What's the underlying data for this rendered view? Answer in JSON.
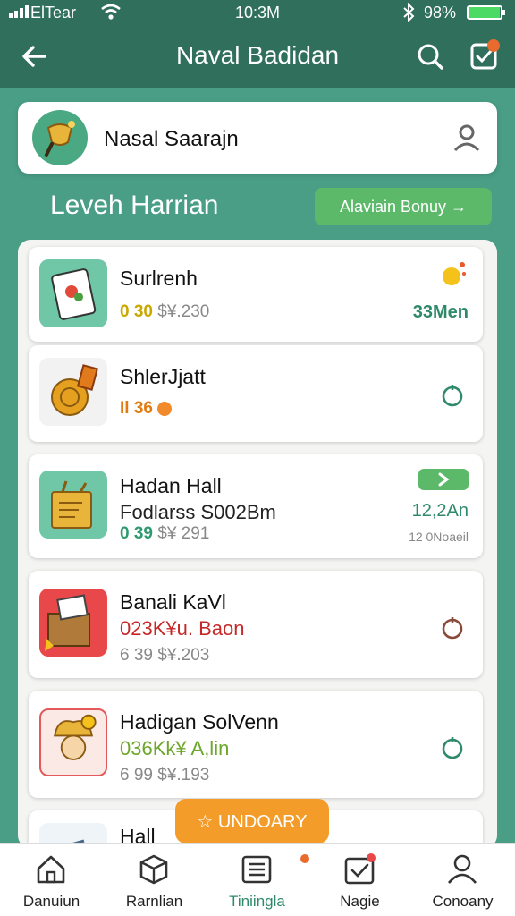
{
  "status_bar": {
    "carrier": "ElTear",
    "time": "10:3M",
    "battery": "98%",
    "battery_level": 0.98
  },
  "header": {
    "title": "Naval Badidan",
    "icons": [
      "back-arrow-icon",
      "search-icon",
      "tasks-icon"
    ]
  },
  "profile": {
    "name": "Nasal Saarajn",
    "icon": "person-icon"
  },
  "section": {
    "title": "Leveh Harrian",
    "button_label": "Alaviain Bonuy →"
  },
  "items": [
    {
      "name": "Surlrenh",
      "meta_highlight": "0 30",
      "meta_rest": " $¥.230",
      "right_value": "33Men",
      "accent": "#c9a800"
    },
    {
      "name": "ShlerJjatt",
      "meta_highlight": "Il 36",
      "meta_rest": "",
      "accent": "#e27a12"
    },
    {
      "name": "Hadan Hall",
      "subtitle": "Fodlarss S002Bm",
      "meta_highlight": "0 39",
      "meta_rest": " $¥ 291",
      "right_value": "12,2An",
      "right_sub": "12 0Noaeil",
      "accent": "#2f9a6f"
    },
    {
      "name": "Banali KaVl",
      "subtitle": "023K¥u. Baon",
      "meta_rest": "6 39 $¥.203",
      "accent": "#c62828"
    },
    {
      "name": "Hadigan SolVenn",
      "subtitle": "036Kk¥ A,lin",
      "meta_rest": "6 99 $¥.193",
      "accent": "#6ca62a"
    },
    {
      "name": "Hall",
      "accent": "#555555"
    }
  ],
  "upgrade_button": {
    "label": "UNDOARY",
    "color": "#f39c2a"
  },
  "bottom_nav": [
    {
      "label": "Danuiun",
      "icon": "home-icon"
    },
    {
      "label": "Rarnlian",
      "icon": "box-icon"
    },
    {
      "label": "Tiniingla",
      "icon": "list-icon",
      "active": true
    },
    {
      "label": "Nagie",
      "icon": "calendar-check-icon"
    },
    {
      "label": "Conoany",
      "icon": "person-icon"
    }
  ],
  "colors": {
    "primary": "#2f6f5c",
    "background": "#4a9e86",
    "accent_green": "#5cb96a",
    "accent_orange": "#f39c2a"
  }
}
